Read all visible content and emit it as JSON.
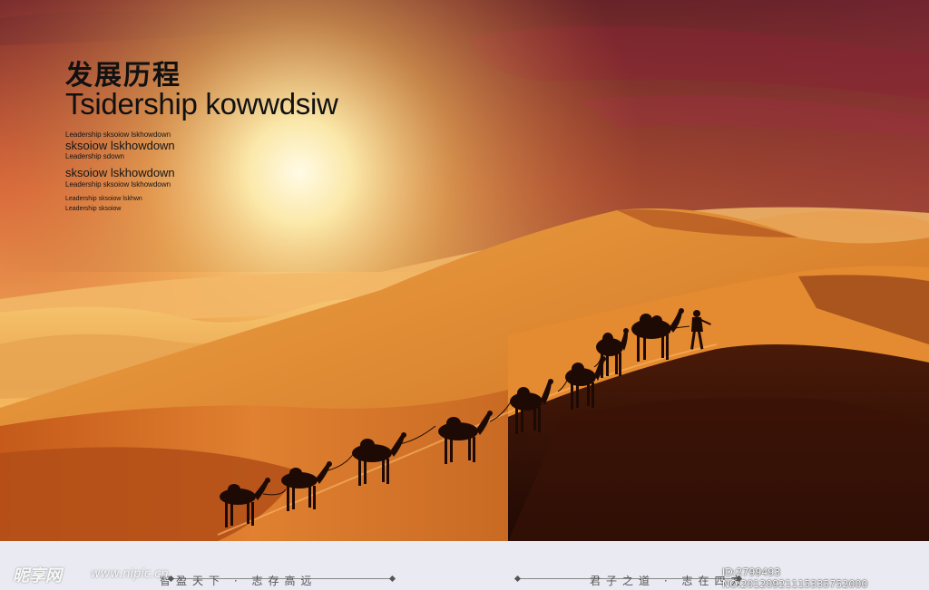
{
  "heading": {
    "title_zh": "发展历程",
    "title_en": "Tsidership kowwdsiw"
  },
  "subtitles": [
    "Leadership sksoiow lskhowdown",
    "sksoiow lskhowdown",
    "Leadership sdown",
    "sksoiow lskhowdown",
    "Leadership sksoiow lskhowdown",
    "Leadership sksoiow lskhwn",
    "Leadership sksoiow"
  ],
  "footer": {
    "slogan_left": "智盈天下 · 志存高远",
    "slogan_right": "君子之道 · 志在四方"
  },
  "watermark": {
    "site_name": "昵享网",
    "url": "www.nipic.cn",
    "id": "ID:2799493 NO:20120921115335752000"
  },
  "colors": {
    "sky_top": "#8a2a2a",
    "sun": "#fff6c8",
    "dune_light": "#f0a040",
    "dune_shadow": "#3a1506",
    "footer_bg": "#e9eaf2"
  }
}
